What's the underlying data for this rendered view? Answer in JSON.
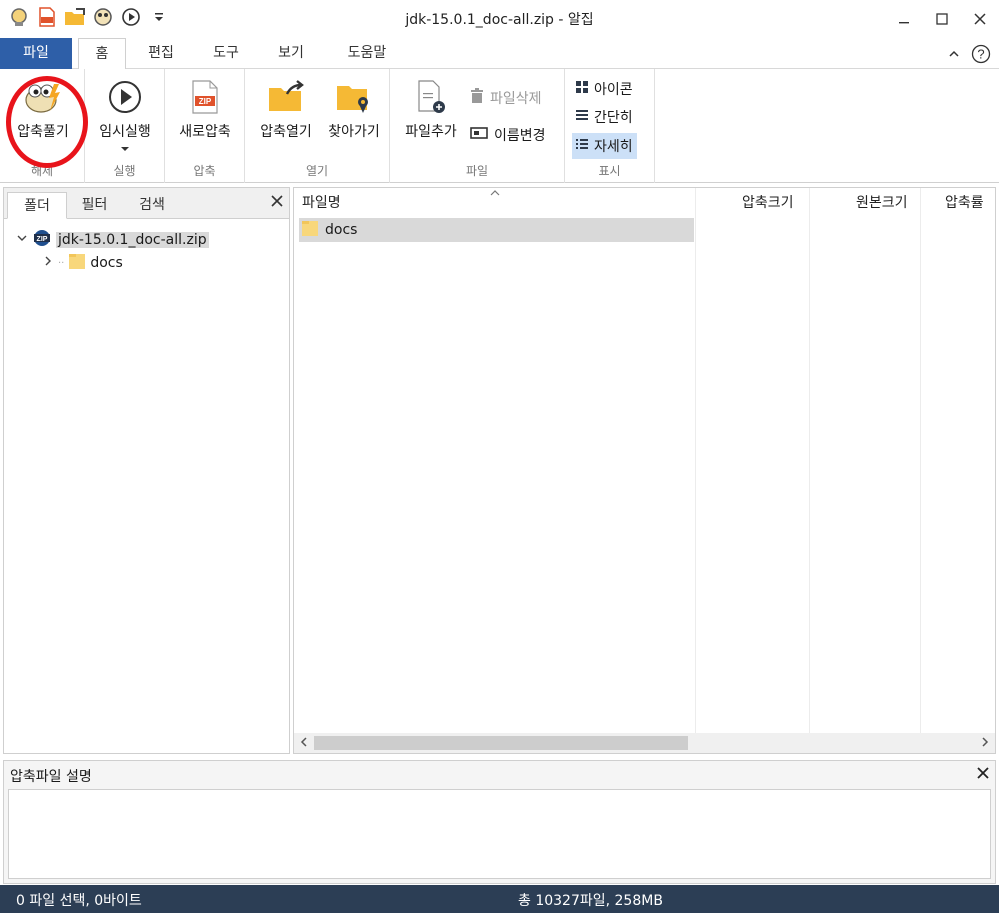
{
  "window": {
    "title": "jdk-15.0.1_doc-all.zip - 알집",
    "minimize_icon": "minimize-icon",
    "maximize_icon": "maximize-icon",
    "close_icon": "close-icon"
  },
  "quick_access": [
    "alzip-logo-icon",
    "new-zip-icon",
    "open-folder-icon",
    "extract-icon",
    "run-icon",
    "customize-dropdown-icon"
  ],
  "menu_tabs": {
    "file": "파일",
    "home": "홈",
    "edit": "편집",
    "tools": "도구",
    "view": "보기",
    "help": "도움말"
  },
  "ribbon": {
    "extract": {
      "label": "압축풀기",
      "group": "해제"
    },
    "temp_run": {
      "label": "임시실행",
      "group": "실행"
    },
    "new_zip": {
      "label": "새로압축",
      "group": "압축"
    },
    "open_archive": {
      "label": "압축열기"
    },
    "find": {
      "label": "찾아가기",
      "group": "열기"
    },
    "add_file": {
      "label": "파일추가"
    },
    "delete_file": {
      "label": "파일삭제"
    },
    "rename": {
      "label": "이름변경",
      "group": "파일"
    },
    "view_icons": {
      "label": "아이콘"
    },
    "view_simple": {
      "label": "간단히"
    },
    "view_details": {
      "label": "자세히",
      "group": "표시"
    }
  },
  "left_pane": {
    "tabs": [
      "폴더",
      "필터",
      "검색"
    ],
    "tree": {
      "root": "jdk-15.0.1_doc-all.zip",
      "child": "docs"
    }
  },
  "file_list": {
    "columns": [
      "파일명",
      "압축크기",
      "원본크기",
      "압축률"
    ],
    "rows": [
      {
        "name": "docs"
      }
    ]
  },
  "description": {
    "title": "압축파일 설명"
  },
  "status": {
    "selection": "0 파일 선택,  0바이트",
    "total": "총 10327파일,  258MB"
  },
  "colors": {
    "file_tab": "#2e5fa8",
    "status_bar": "#2c3e55",
    "annotation_circle": "#e8141b",
    "selection": "#cce0f7"
  }
}
